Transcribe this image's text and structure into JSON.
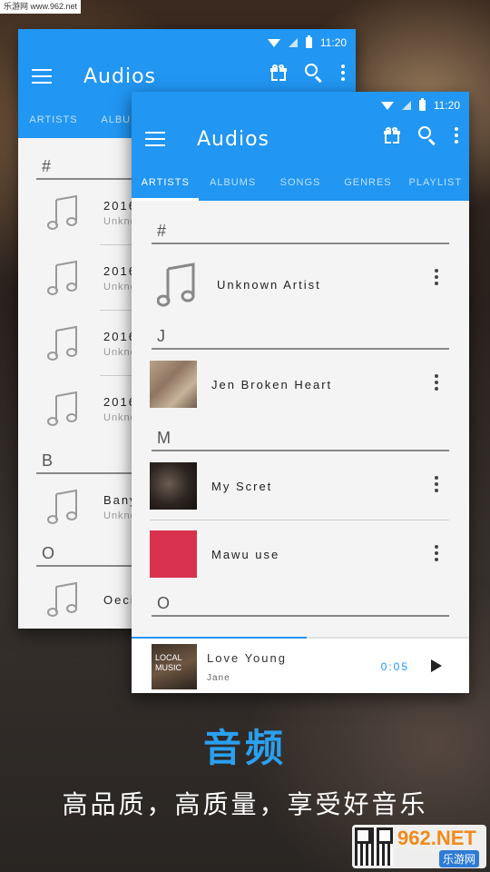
{
  "site_tag": "乐游网 www.962.net",
  "status": {
    "time": "11:20"
  },
  "app": {
    "title": "Audios"
  },
  "tabs": [
    "ARTISTS",
    "ALBUMS",
    "SONGS",
    "GENRES",
    "PLAYLIST"
  ],
  "back_list": {
    "section_hash": "#",
    "rows": [
      {
        "name": "2016",
        "sub": "Unkno"
      },
      {
        "name": "2016",
        "sub": "Unkno"
      },
      {
        "name": "2016",
        "sub": "Unkno"
      },
      {
        "name": "2016",
        "sub": "Unkno"
      }
    ],
    "section_b": "B",
    "row_b": {
      "name": "Banyo",
      "sub": "Unkno"
    },
    "section_o": "O",
    "row_o": {
      "name": "Oecit"
    }
  },
  "front_list": {
    "sections": {
      "hash": "#",
      "j": "J",
      "m": "M",
      "o": "O"
    },
    "artists": [
      {
        "name": "Unknown Artist"
      },
      {
        "name": "Jen Broken Heart"
      },
      {
        "name": "My Scret"
      },
      {
        "name": "Mawu use"
      }
    ]
  },
  "player": {
    "song": "Love Young",
    "artist": "Jane",
    "time": "0:05",
    "progress": 0.52,
    "cover_text": "LOCAL MUSIC"
  },
  "promo": {
    "headline": "音频",
    "subline": "高品质，高质量，享受好音乐"
  },
  "watermark": {
    "brand": "962.NET",
    "brand_cn": "乐游网"
  },
  "colors": {
    "accent": "#2196f3",
    "headline": "#2aa0f0"
  }
}
